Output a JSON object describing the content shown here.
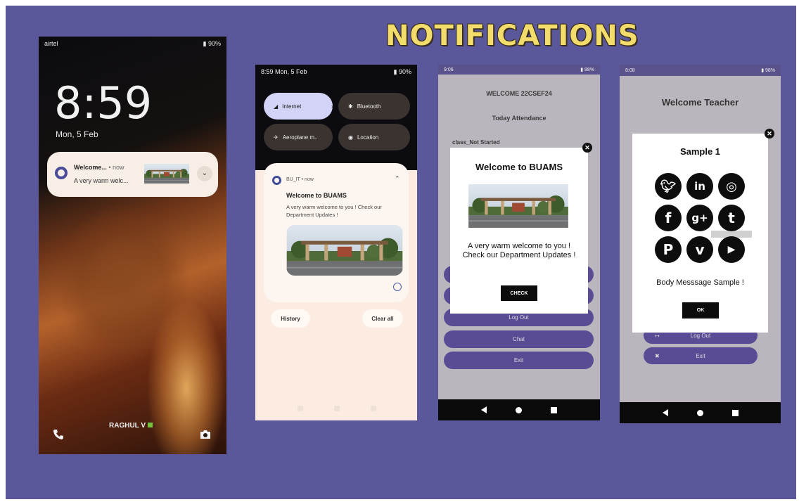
{
  "slide": {
    "title": "NOTIFICATIONS",
    "background": "#5a579b",
    "title_color": "#f2dc6b"
  },
  "lock_screen": {
    "carrier": "airtel",
    "battery": "90%",
    "time": "8:59",
    "date": "Mon, 5 Feb",
    "notification": {
      "title": "Welcome...",
      "meta": "• now",
      "body": "A very warm welc..."
    },
    "owner": "RAGHUL V",
    "icons": [
      "phone-icon",
      "camera-icon",
      "expand-chevron-icon"
    ]
  },
  "shade": {
    "status_time": "8:59 Mon, 5 Feb",
    "battery": "90%",
    "tiles": [
      {
        "label": "Internet",
        "state": "on"
      },
      {
        "label": "Bluetooth",
        "state": "off"
      },
      {
        "label": "Aeroplane m..",
        "state": "off"
      },
      {
        "label": "Location",
        "state": "off"
      }
    ],
    "notification": {
      "app": "BU_IT • now",
      "title": "Welcome to BUAMS",
      "body": "A very warm welcome to you ! Check our Department Updates !"
    },
    "history_label": "History",
    "clear_label": "Clear all"
  },
  "student_app": {
    "status_time": "9:06",
    "battery": "88%",
    "welcome": "WELCOME 22CSEF24",
    "attendance": "Today Attendance",
    "class_status": "class_Not Started",
    "buttons": [
      "Log Out",
      "Chat",
      "Exit"
    ],
    "dialog": {
      "title": "Welcome to BUAMS",
      "message": "A very warm welcome to you ! Check our Department Updates !",
      "button": "CHECK"
    }
  },
  "teacher_app": {
    "status_time": "8:08",
    "battery": "98%",
    "welcome": "Welcome Teacher",
    "buttons": [
      "Log Out",
      "Exit"
    ],
    "dialog": {
      "title": "Sample 1",
      "social_icons": [
        "twitter-icon",
        "linkedin-icon",
        "instagram-icon",
        "facebook-icon",
        "google-plus-icon",
        "tumblr-icon",
        "pinterest-icon",
        "vimeo-icon",
        "youtube-icon"
      ],
      "body": "Body Messsage Sample !",
      "button": "OK"
    }
  }
}
